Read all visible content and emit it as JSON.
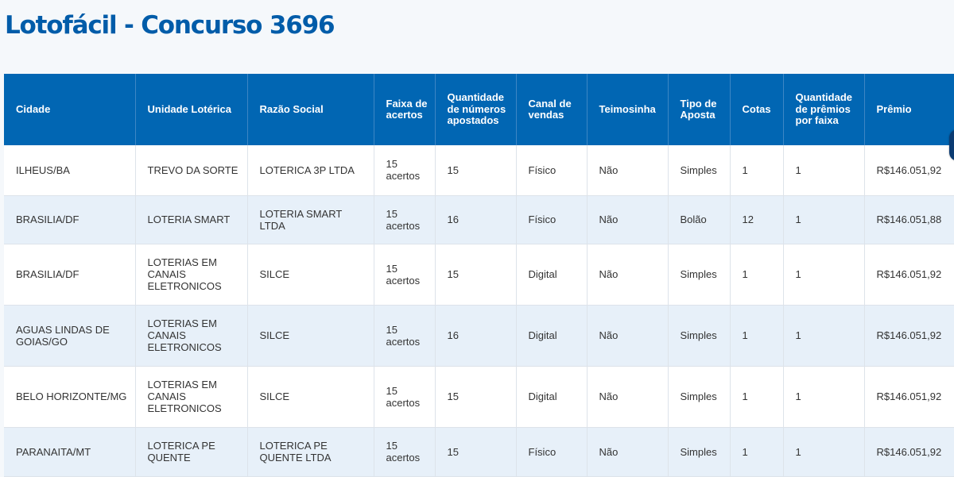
{
  "page": {
    "title": "Lotofácil - Concurso 3696"
  },
  "table": {
    "headers": [
      "Cidade",
      "Unidade Lotérica",
      "Razão Social",
      "Faixa de acertos",
      "Quantidade de números apostados",
      "Canal de vendas",
      "Teimosinha",
      "Tipo de Aposta",
      "Cotas",
      "Quantidade de prêmios por faixa",
      "Prêmio"
    ],
    "rows": [
      [
        "ILHEUS/BA",
        "TREVO DA SORTE",
        "LOTERICA 3P LTDA",
        "15 acertos",
        "15",
        "Físico",
        "Não",
        "Simples",
        "1",
        "1",
        "R$146.051,92"
      ],
      [
        "BRASILIA/DF",
        "LOTERIA SMART",
        "LOTERIA SMART LTDA",
        "15 acertos",
        "16",
        "Físico",
        "Não",
        "Bolão",
        "12",
        "1",
        "R$146.051,88"
      ],
      [
        "BRASILIA/DF",
        "LOTERIAS EM CANAIS ELETRONICOS",
        "SILCE",
        "15 acertos",
        "15",
        "Digital",
        "Não",
        "Simples",
        "1",
        "1",
        "R$146.051,92"
      ],
      [
        "AGUAS LINDAS DE GOIAS/GO",
        "LOTERIAS EM CANAIS ELETRONICOS",
        "SILCE",
        "15 acertos",
        "16",
        "Digital",
        "Não",
        "Simples",
        "1",
        "1",
        "R$146.051,92"
      ],
      [
        "BELO HORIZONTE/MG",
        "LOTERIAS EM CANAIS ELETRONICOS",
        "SILCE",
        "15 acertos",
        "15",
        "Digital",
        "Não",
        "Simples",
        "1",
        "1",
        "R$146.051,92"
      ],
      [
        "PARANAITA/MT",
        "LOTERICA PE QUENTE",
        "LOTERICA PE QUENTE LTDA",
        "15 acertos",
        "15",
        "Físico",
        "Não",
        "Simples",
        "1",
        "1",
        "R$146.051,92"
      ]
    ]
  },
  "colors": {
    "title": "#005ca9",
    "header_bg": "#0166b3",
    "row_alt_bg": "#e7f0f9",
    "page_bg": "#f5f8fb"
  }
}
